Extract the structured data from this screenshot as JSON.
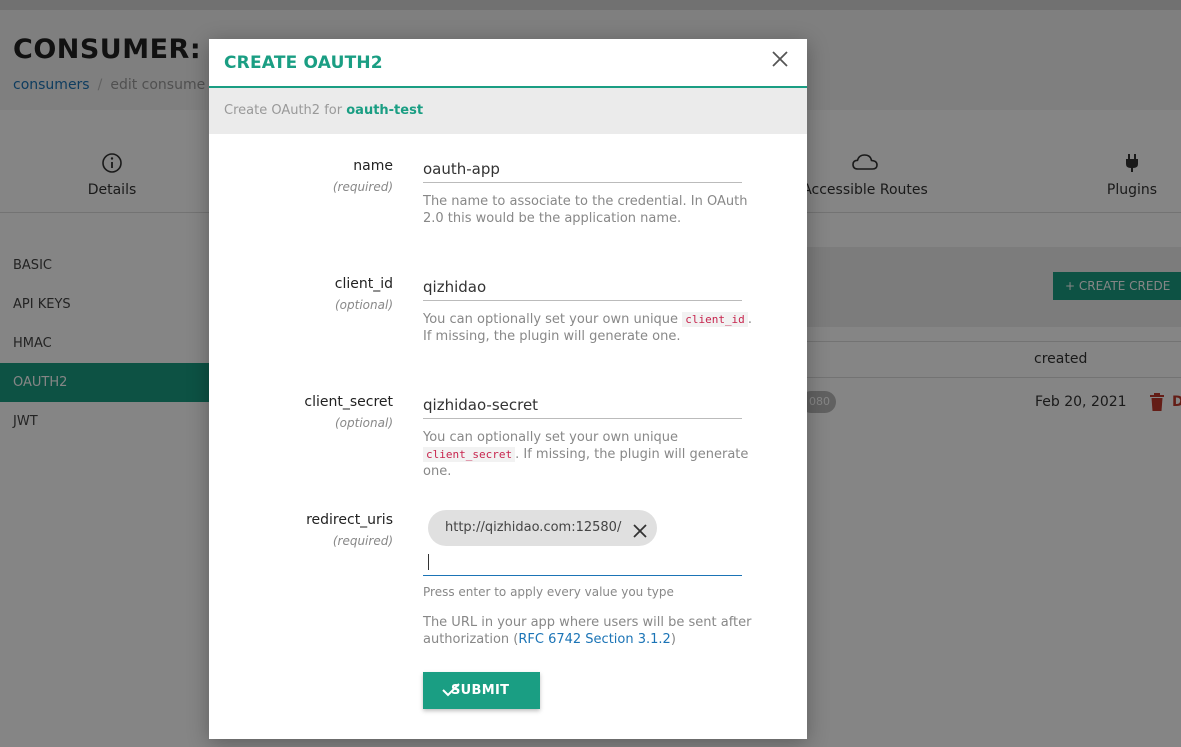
{
  "background": {
    "page_title": "CONSUMER: o",
    "breadcrumb": {
      "link": "consumers",
      "separator": "/",
      "current": "edit consume"
    },
    "tabs": [
      {
        "label": "Details",
        "icon": "info-icon"
      },
      {
        "label": "Accessible Routes",
        "icon": "cloud-icon"
      },
      {
        "label": "Plugins",
        "icon": "plug-icon"
      }
    ],
    "sidebar": {
      "items": [
        {
          "label": "BASIC"
        },
        {
          "label": "API KEYS"
        },
        {
          "label": "HMAC"
        },
        {
          "label": "OAUTH2"
        },
        {
          "label": "JWT"
        }
      ],
      "active": "OAUTH2"
    },
    "create_credential_label": "+ CREATE CREDE",
    "table": {
      "header_created": "created",
      "row_badge": "080",
      "row_created": "Feb 20, 2021",
      "row_action_tail": "D"
    }
  },
  "modal": {
    "title": "CREATE OAUTH2",
    "close_icon": "close-icon",
    "subheader_prefix": "Create OAuth2 for",
    "consumer_name": "oauth-test",
    "fields": {
      "name": {
        "label": "name",
        "hint": "(required)",
        "value": "oauth-app",
        "help": "The name to associate to the credential. In OAuth 2.0 this would be the application name."
      },
      "client_id": {
        "label": "client_id",
        "hint": "(optional)",
        "value": "qizhidao",
        "help_before": "You can optionally set your own unique",
        "help_code": "client_id",
        "help_after": ". If missing, the plugin will generate one."
      },
      "client_secret": {
        "label": "client_secret",
        "hint": "(optional)",
        "value": "qizhidao-secret",
        "help_before": "You can optionally set your own unique",
        "help_code": "client_secret",
        "help_after": ". If missing, the plugin will generate one."
      },
      "redirect_uris": {
        "label": "redirect_uris",
        "hint": "(required)",
        "chip": "http://qizhidao.com:12580/",
        "input_hint": "Press enter to apply every value you type",
        "help_before": "The URL in your app where users will be sent after authorization (",
        "help_link": "RFC 6742 Section 3.1.2",
        "help_after": ")"
      }
    },
    "submit_label": "SUBMIT"
  },
  "colors": {
    "accent": "#1a9e83",
    "link": "#1b74b6",
    "danger": "#c0392b"
  }
}
